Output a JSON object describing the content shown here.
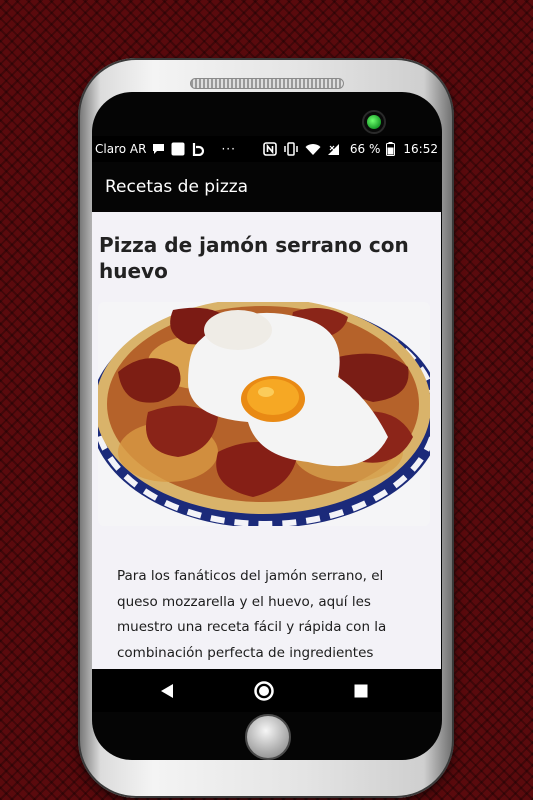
{
  "status_bar": {
    "carrier": "Claro AR",
    "icons": [
      "chat-bubble-icon",
      "white-square-icon",
      "b-app-icon",
      "more-dots-icon",
      "nfc-icon",
      "vibrate-icon",
      "wifi-icon",
      "signal-icon"
    ],
    "dots": "···",
    "battery": "66 %",
    "time": "16:52"
  },
  "app_bar": {
    "title": "Recetas de pizza"
  },
  "article": {
    "title": "Pizza de jamón serrano con huevo",
    "image": "pizza-with-egg-image",
    "paragraph_lines": [
      "Para los fanáticos del jamón serrano, el",
      "queso mozzarella y el huevo, aquí les",
      "muestro una receta fácil y rápida con la",
      "combinación perfecta de ingredientes"
    ]
  },
  "nav_bar": {
    "icons": [
      "back-triangle-icon",
      "home-circle-icon",
      "recents-square-icon"
    ]
  },
  "colors": {
    "background": "#5a0a0d",
    "screen_bg": "#f3f2f7",
    "bars": "#000000",
    "led": "#2fbf3a"
  }
}
